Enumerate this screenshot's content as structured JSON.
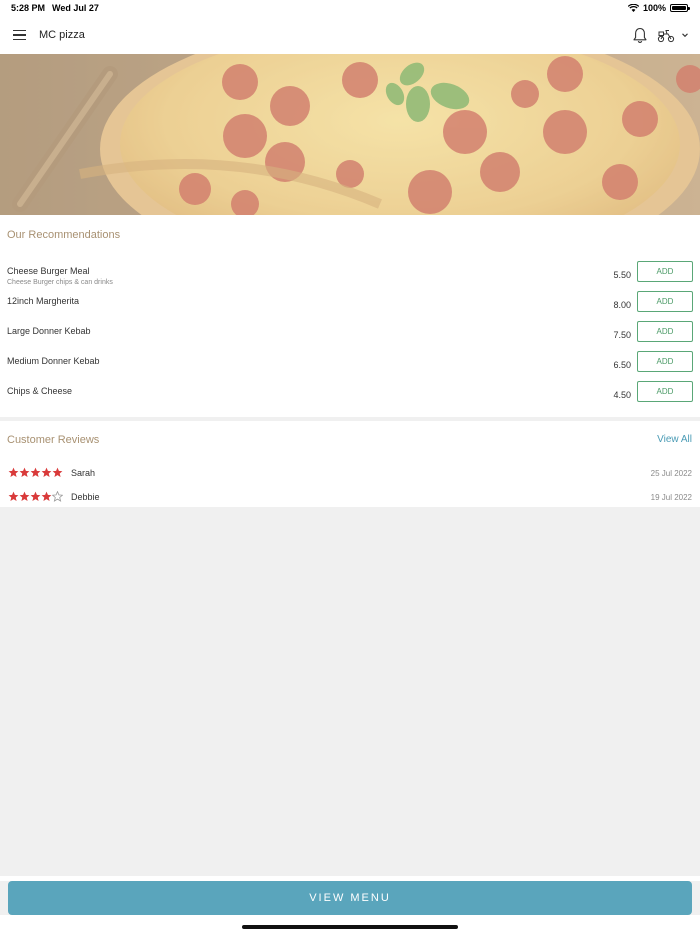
{
  "status_bar": {
    "time": "5:28 PM",
    "date": "Wed Jul 27",
    "battery": "100%",
    "icons": [
      "wifi-icon",
      "battery-icon"
    ]
  },
  "header": {
    "title": "MC pizza",
    "icons": [
      "hamburger-menu-icon",
      "bell-icon",
      "delivery-scooter-icon",
      "chevron-down-icon"
    ]
  },
  "hero": {
    "image": "pepperoni-pizza-photo"
  },
  "recommendations": {
    "title": "Our Recommendations",
    "add_label": "ADD",
    "items": [
      {
        "name": "Cheese Burger Meal",
        "description": "Cheese Burger chips & can drinks",
        "price": "5.50"
      },
      {
        "name": "12inch Margherita",
        "description": "",
        "price": "8.00"
      },
      {
        "name": "Large Donner Kebab",
        "description": "",
        "price": "7.50"
      },
      {
        "name": "Medium Donner Kebab",
        "description": "",
        "price": "6.50"
      },
      {
        "name": "Chips & Cheese",
        "description": "",
        "price": "4.50"
      }
    ]
  },
  "reviews": {
    "title": "Customer Reviews",
    "view_all_label": "View All",
    "items": [
      {
        "name": "Sarah",
        "rating": 5,
        "date": "25 Jul 2022"
      },
      {
        "name": "Debbie",
        "rating": 4,
        "date": "19 Jul 2022"
      }
    ]
  },
  "footer": {
    "view_menu_label": "VIEW MENU"
  },
  "colors": {
    "accent": "#5aa5bc",
    "add_border": "#5aa777",
    "section_title": "#a89172",
    "star": "#d93a3a",
    "link": "#4a9bb5"
  }
}
